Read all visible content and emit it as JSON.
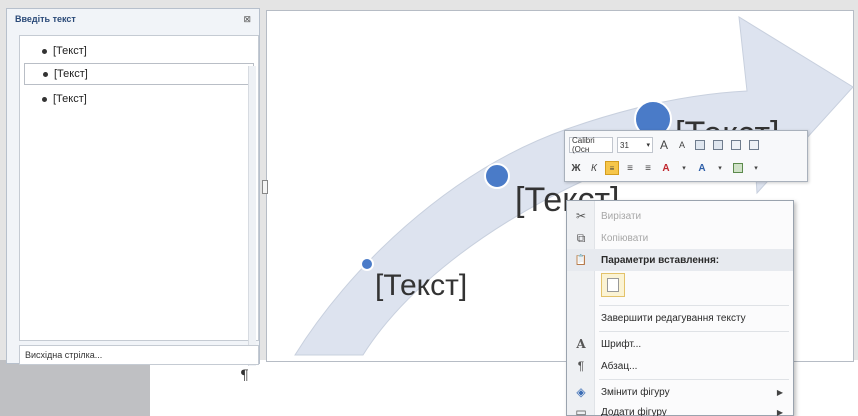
{
  "text_pane": {
    "title": "Введіть текст",
    "close_glyph": "⊠",
    "items": [
      {
        "label": "[Текст]"
      },
      {
        "label": "[Текст]"
      },
      {
        "label": "[Текст]"
      }
    ],
    "footer": "Висхідна стрілка..."
  },
  "slide": {
    "nodes": [
      "[Текст]",
      "[Текст]",
      "[Текст]"
    ]
  },
  "mini_toolbar": {
    "font": "Calibri (Осн",
    "size": "31",
    "grow": "A",
    "shrink": "A",
    "bold": "Ж",
    "italic": "К",
    "font_color": "A",
    "fill": "A"
  },
  "context_menu": {
    "items": [
      {
        "label": "Вирізати",
        "icon": "✂",
        "disabled": true
      },
      {
        "label": "Копіювати",
        "icon": "⧉",
        "disabled": true
      },
      {
        "label": "Параметри вставлення:",
        "icon": "📋",
        "bold": true
      },
      {
        "label": "Завершити редагування тексту",
        "icon": ""
      },
      {
        "label": "Шрифт...",
        "icon": "A"
      },
      {
        "label": "Абзац...",
        "icon": "¶"
      },
      {
        "label": "Змінити фігуру",
        "icon": "◈",
        "submenu": true
      },
      {
        "label": "Додати фігуру",
        "icon": "▭",
        "submenu": true
      }
    ]
  },
  "colors": {
    "arrow": "#dde3ef",
    "node": "#4a7bc8",
    "highlight": "#f6c64a"
  },
  "paragraph_mark": "¶"
}
